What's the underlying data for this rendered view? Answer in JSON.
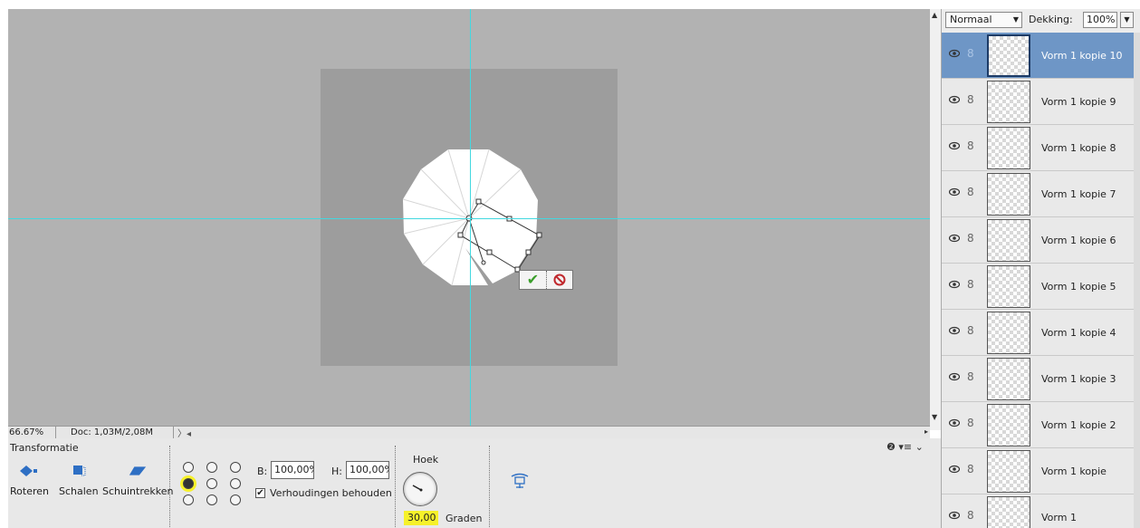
{
  "canvas": {
    "commit_icon": "check-icon",
    "cancel_icon": "cancel-icon"
  },
  "status": {
    "zoom": "66.67%",
    "doc": "Doc: 1,03M/2,08M",
    "arrows": "〉◂"
  },
  "options": {
    "title": "Transformatie",
    "modes": [
      {
        "label": "Roteren",
        "icon": "rotate-icon"
      },
      {
        "label": "Schalen",
        "icon": "scale-icon"
      },
      {
        "label": "Schuintrekken",
        "icon": "skew-icon"
      }
    ],
    "width_label": "B:",
    "width_value": "100,00%",
    "height_label": "H:",
    "height_value": "100,00%",
    "keep_proportions_label": "Verhoudingen behouden",
    "keep_proportions_checked": true,
    "angle_label": "Hoek",
    "angle_value": "30,00",
    "angle_unit": "Graden",
    "reference_point_selected": "middle-left",
    "help_icons": "❷ ▾≡ ⌄",
    "highlight_color": "#f6f12a"
  },
  "layers": {
    "blend_mode": "Normaal",
    "opacity_label": "Dekking:",
    "opacity_value": "100%",
    "items": [
      {
        "name": "Vorm 1 kopie 10",
        "active": true
      },
      {
        "name": "Vorm 1 kopie 9",
        "active": false
      },
      {
        "name": "Vorm 1 kopie 8",
        "active": false
      },
      {
        "name": "Vorm 1 kopie 7",
        "active": false
      },
      {
        "name": "Vorm 1 kopie 6",
        "active": false
      },
      {
        "name": "Vorm 1 kopie 5",
        "active": false
      },
      {
        "name": "Vorm 1 kopie 4",
        "active": false
      },
      {
        "name": "Vorm 1 kopie 3",
        "active": false
      },
      {
        "name": "Vorm 1 kopie 2",
        "active": false
      },
      {
        "name": "Vorm 1 kopie",
        "active": false
      },
      {
        "name": "Vorm 1",
        "active": false
      }
    ],
    "active_color": "#6e96c6"
  }
}
